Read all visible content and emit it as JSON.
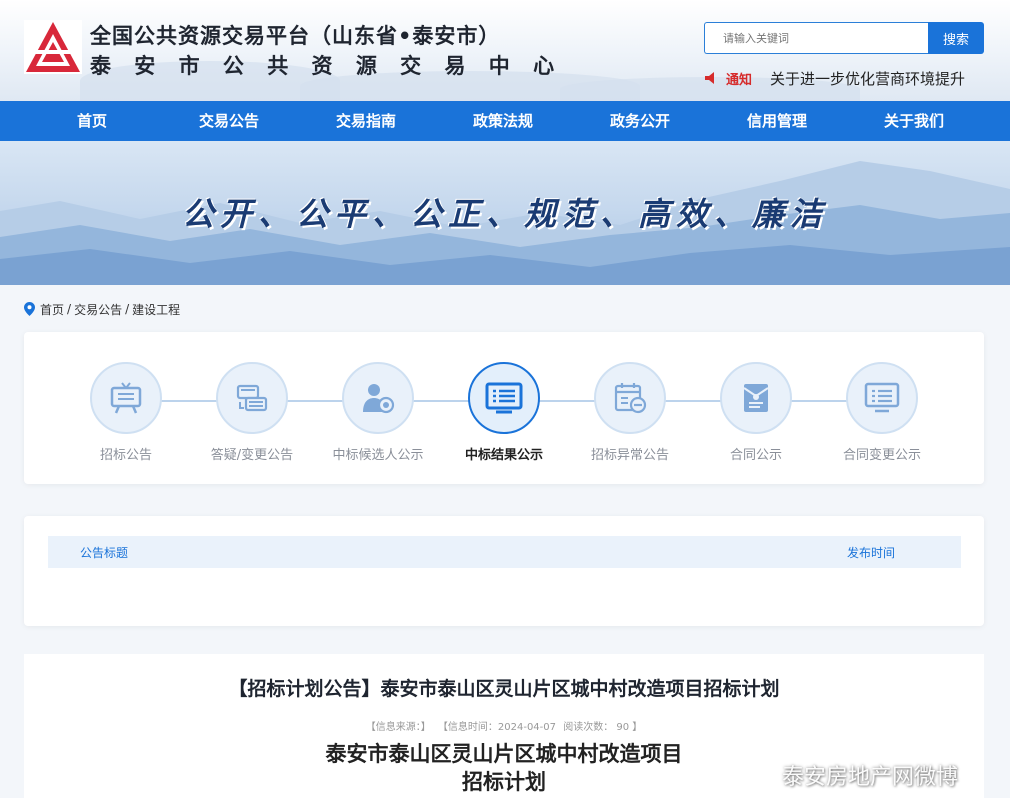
{
  "header": {
    "title_line1": "全国公共资源交易平台（山东省•泰安市）",
    "title_line2": "泰 安 市 公 共 资 源 交 易 中 心",
    "search": {
      "placeholder": "请输入关键词",
      "button_label": "搜索"
    },
    "notice": {
      "tag": "通知",
      "text": "关于进一步优化营商环境提升"
    },
    "brand_color": "#1a73d9"
  },
  "nav": {
    "items": [
      {
        "label": "首页"
      },
      {
        "label": "交易公告"
      },
      {
        "label": "交易指南"
      },
      {
        "label": "政策法规"
      },
      {
        "label": "政务公开"
      },
      {
        "label": "信用管理"
      },
      {
        "label": "关于我们"
      }
    ]
  },
  "banner": {
    "slogan": "公开、公平、公正、规范、高效、廉洁"
  },
  "breadcrumb": {
    "items": [
      "首页",
      "交易公告",
      "建设工程"
    ],
    "separator": "/"
  },
  "categories": {
    "items": [
      {
        "label": "招标公告",
        "icon": "billboard-icon",
        "active": false
      },
      {
        "label": "答疑/变更公告",
        "icon": "exchange-cards-icon",
        "active": false
      },
      {
        "label": "中标候选人公示",
        "icon": "person-badge-icon",
        "active": false
      },
      {
        "label": "中标结果公示",
        "icon": "screen-list-icon",
        "active": true
      },
      {
        "label": "招标异常公告",
        "icon": "calendar-minus-icon",
        "active": false
      },
      {
        "label": "合同公示",
        "icon": "envelope-doc-icon",
        "active": false
      },
      {
        "label": "合同变更公示",
        "icon": "monitor-list-icon",
        "active": false
      }
    ]
  },
  "list": {
    "col_title": "公告标题",
    "col_time": "发布时间"
  },
  "article": {
    "title": "【招标计划公告】泰安市泰山区灵山片区城中村改造项目招标计划",
    "meta": {
      "source": "【信息来源：】",
      "time": "【信息时间：2024-04-07",
      "views": "阅读次数： 90 】"
    },
    "doc_title_line1": "泰安市泰山区灵山片区城中村改造项目",
    "doc_title_line2": "招标计划"
  },
  "watermark": {
    "text": "泰安房地产网微博"
  }
}
